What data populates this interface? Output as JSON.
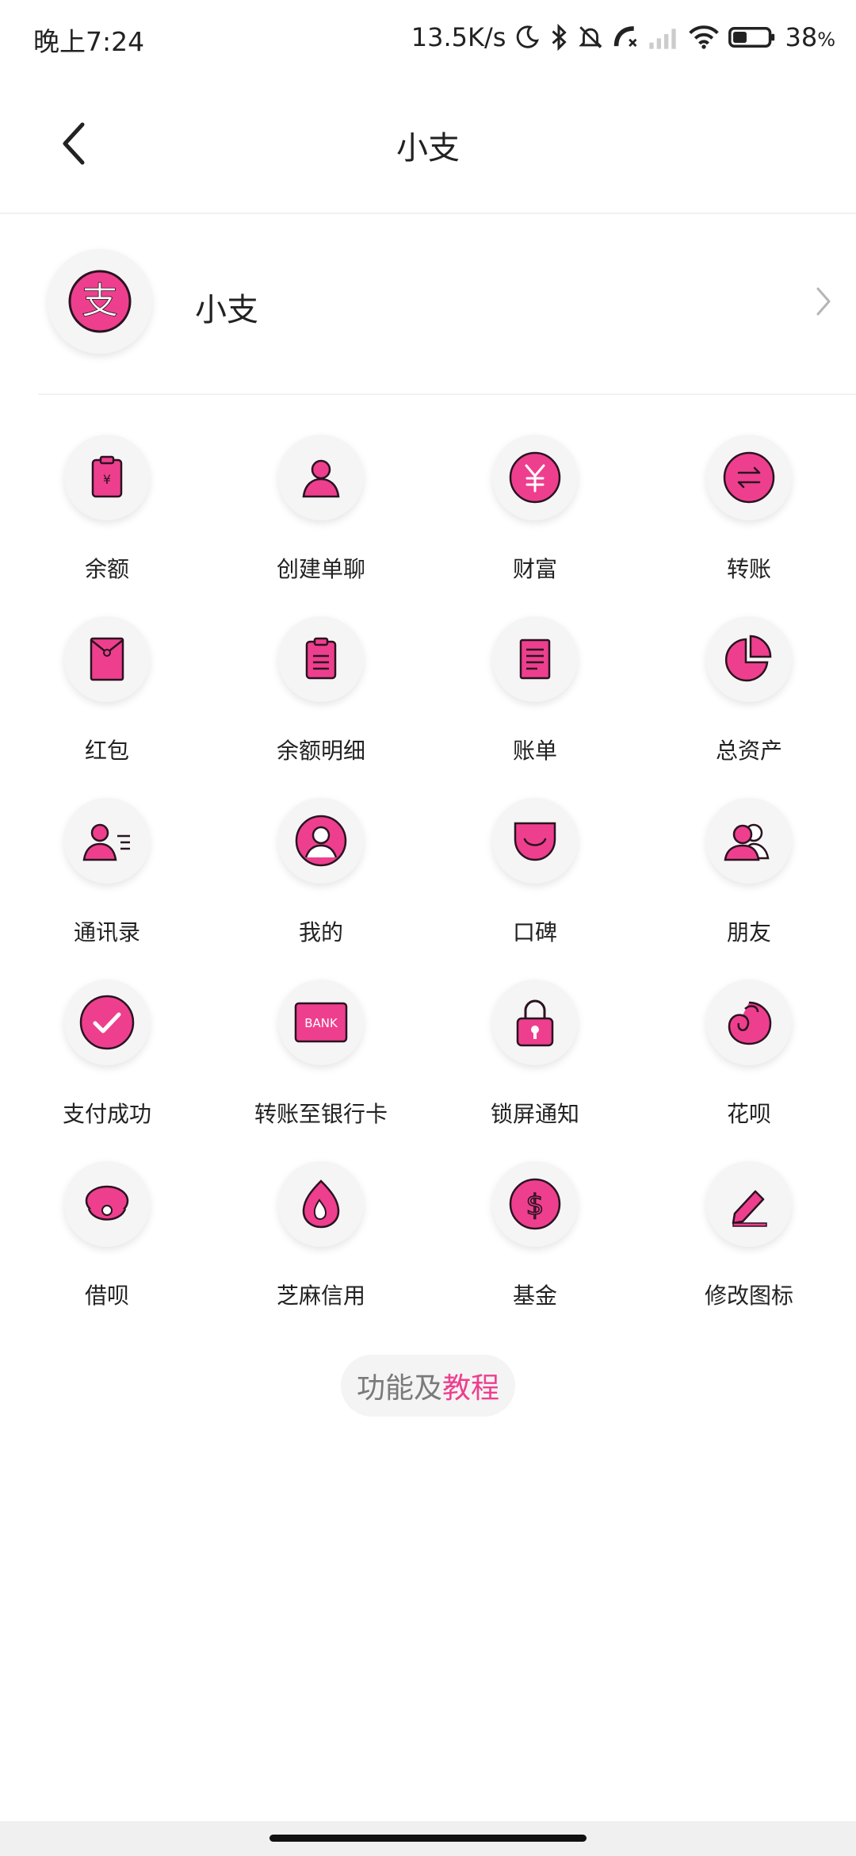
{
  "status_bar": {
    "time": "晚上7:24",
    "net_speed": "13.5K/s",
    "battery": "38",
    "battery_unit": "%",
    "icons": [
      "moon-icon",
      "bluetooth-icon",
      "mute-bell-icon",
      "call-off-icon",
      "signal-icon",
      "wifi-icon",
      "battery-icon"
    ]
  },
  "navbar": {
    "title": "小支"
  },
  "profile": {
    "name": "小支"
  },
  "grid": {
    "items": [
      {
        "label": "余额",
        "icon": "balance-icon"
      },
      {
        "label": "创建单聊",
        "icon": "person-icon"
      },
      {
        "label": "财富",
        "icon": "yuan-coin-icon"
      },
      {
        "label": "转账",
        "icon": "transfer-arrows-icon"
      },
      {
        "label": "红包",
        "icon": "red-envelope-icon"
      },
      {
        "label": "余额明细",
        "icon": "clipboard-icon"
      },
      {
        "label": "账单",
        "icon": "bill-icon"
      },
      {
        "label": "总资产",
        "icon": "pie-chart-icon"
      },
      {
        "label": "通讯录",
        "icon": "contacts-icon"
      },
      {
        "label": "我的",
        "icon": "user-circle-icon"
      },
      {
        "label": "口碑",
        "icon": "smile-bag-icon"
      },
      {
        "label": "朋友",
        "icon": "friends-icon"
      },
      {
        "label": "支付成功",
        "icon": "check-circle-icon"
      },
      {
        "label": "转账至银行卡",
        "icon": "bank-card-icon",
        "icon_text": "BANK"
      },
      {
        "label": "锁屏通知",
        "icon": "lock-icon"
      },
      {
        "label": "花呗",
        "icon": "huabei-icon"
      },
      {
        "label": "借呗",
        "icon": "jiebei-icon"
      },
      {
        "label": "芝麻信用",
        "icon": "sesame-icon"
      },
      {
        "label": "基金",
        "icon": "dollar-coin-icon"
      },
      {
        "label": "修改图标",
        "icon": "edit-pencil-icon"
      }
    ]
  },
  "tutorial": {
    "part1": "功能及",
    "part2": "教程"
  },
  "colors": {
    "accent": "#ee3f8e",
    "outline": "#2a1320",
    "icon_bg": "#f5f5f5"
  }
}
